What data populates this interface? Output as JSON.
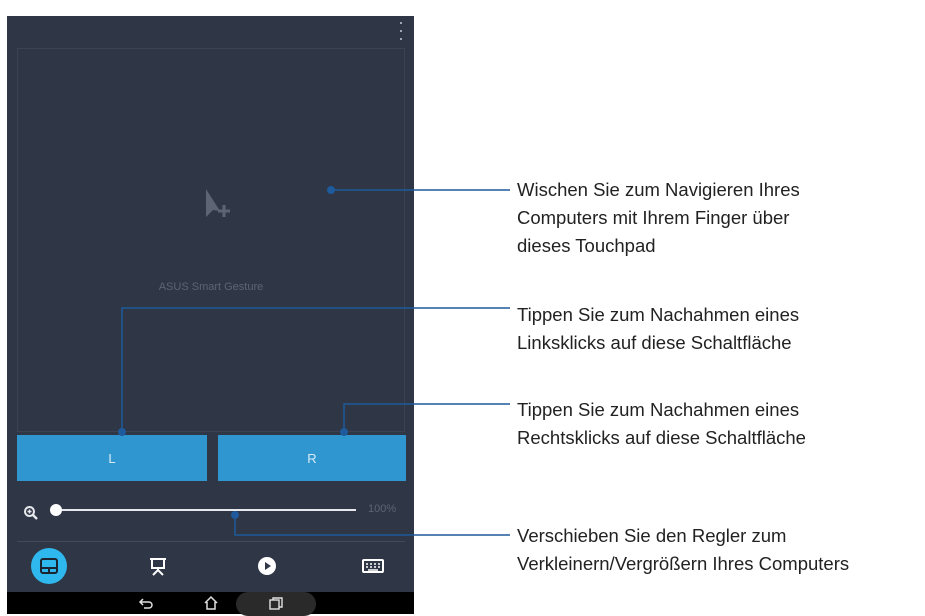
{
  "app": {
    "touchpad_label": "ASUS Smart Gesture",
    "left_button": "L",
    "right_button": "R",
    "zoom_percent": "100%",
    "zoom_level": 0.0,
    "tabs": [
      {
        "icon": "touchpad-icon",
        "active": true
      },
      {
        "icon": "presentation-icon",
        "active": false
      },
      {
        "icon": "play-icon",
        "active": false
      },
      {
        "icon": "keyboard-icon",
        "active": false
      }
    ],
    "navbar": [
      "back-icon",
      "home-icon",
      "recent-apps-icon"
    ],
    "accent_color": "#3096cf",
    "active_tab_color": "#2fb8ee"
  },
  "callouts": {
    "touchpad": {
      "line1": "Wischen Sie zum Navigieren Ihres",
      "line2": "Computers mit Ihrem Finger über",
      "line3": "dieses Touchpad"
    },
    "left_click": {
      "line1": "Tippen Sie zum Nachahmen eines",
      "line2": "Linksklicks auf diese Schaltfläche"
    },
    "right_click": {
      "line1": "Tippen Sie zum Nachahmen eines",
      "line2": "Rechtsklicks auf diese Schaltfläche"
    },
    "slider": {
      "line1": "Verschieben Sie den Regler zum",
      "line2": "Verkleinern/Vergrößern Ihres Computers"
    }
  },
  "callout_line_color": "#1e5a9c"
}
